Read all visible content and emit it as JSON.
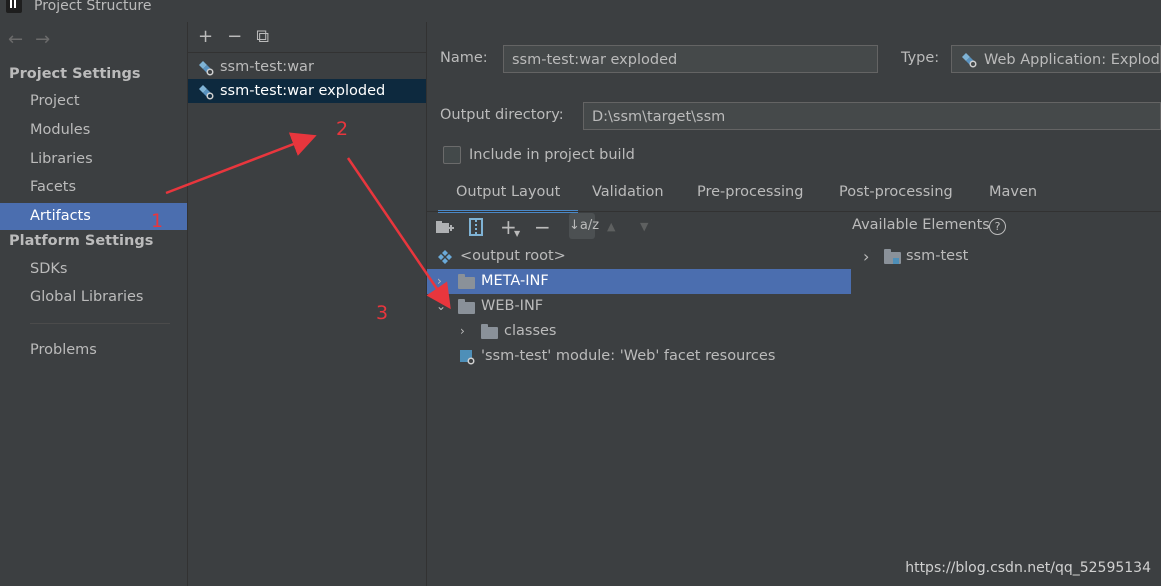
{
  "window": {
    "title": "Project Structure"
  },
  "nav": {
    "back_arrow": "←",
    "forward_arrow": "→",
    "project_settings_header": "Project Settings",
    "project_items": [
      "Project",
      "Modules",
      "Libraries",
      "Facets",
      "Artifacts"
    ],
    "selected": "Artifacts",
    "platform_settings_header": "Platform Settings",
    "platform_items": [
      "SDKs",
      "Global Libraries"
    ],
    "problems": "Problems"
  },
  "artifacts_toolbar": {
    "add": "+",
    "remove": "−",
    "copy": "⧉"
  },
  "artifacts": [
    "ssm-test:war",
    "ssm-test:war exploded"
  ],
  "form": {
    "name_label": "Name:",
    "name_value": "ssm-test:war exploded",
    "type_label": "Type:",
    "type_value": "Web Application: Exploded",
    "output_dir_label": "Output directory:",
    "output_dir_value": "D:\\ssm\\target\\ssm",
    "include_in_build_label": "Include in project build",
    "include_in_build_checked": false
  },
  "tabs": [
    "Output Layout",
    "Validation",
    "Pre-processing",
    "Post-processing",
    "Maven"
  ],
  "active_tab": "Output Layout",
  "tree_toolbar": {
    "add": "+",
    "remove": "−",
    "sort": "↓a/z",
    "up": "▲",
    "down": "▼"
  },
  "tree": {
    "root": "<output root>",
    "meta_inf": "META-INF",
    "web_inf": "WEB-INF",
    "classes": "classes",
    "facet_resources": "'ssm-test' module: 'Web' facet resources"
  },
  "available": {
    "title": "Available Elements",
    "help": "?",
    "item": "ssm-test"
  },
  "annotations": {
    "one": "1",
    "two": "2",
    "three": "3"
  },
  "watermark": "https://blog.csdn.net/qq_52595134",
  "colors": {
    "selection": "#4b6eaf",
    "annotation_red": "#e8363d",
    "bg": "#3c3f41"
  }
}
